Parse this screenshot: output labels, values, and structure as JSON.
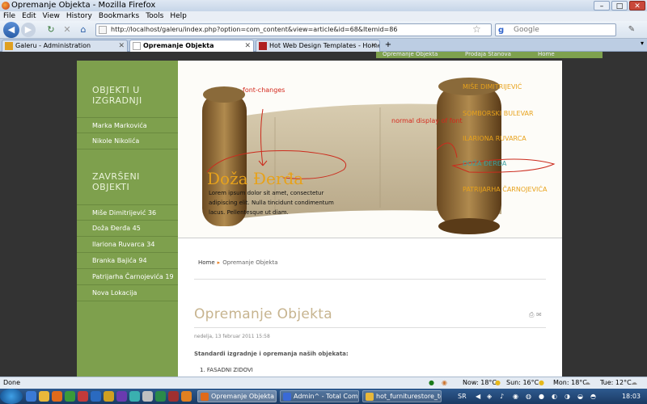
{
  "window": {
    "title": "Opremanje Objekta - Mozilla Firefox",
    "min": "–",
    "max": "□",
    "close": "✕"
  },
  "menu": [
    "File",
    "Edit",
    "View",
    "History",
    "Bookmarks",
    "Tools",
    "Help"
  ],
  "nav": {
    "url": "http://localhost/galeru/index.php?option=com_content&view=article&id=68&Itemid=86",
    "search_placeholder": "Google"
  },
  "tabs": [
    {
      "label": "Galeru - Administration",
      "active": false
    },
    {
      "label": "Opremanje Objekta",
      "active": true
    },
    {
      "label": "Hot Web Design Templates - Home",
      "active": false
    }
  ],
  "site": {
    "top_menu": [
      "Opremanje Objekta",
      "Prodaja Stanova",
      "Home"
    ],
    "sidebar": {
      "section1_title": "OBJEKTI U IZGRADNJI",
      "section1_items": [
        "Marka Markovića",
        "Nikole Nikolića"
      ],
      "section2_title": "ZAVRŠENI OBJEKTI",
      "section2_items": [
        "Miše Dimitrijević 36",
        "Doža Đerđa 45",
        "Ilariona Ruvarca 34",
        "Branka Bajića 94",
        "Patrijarha Čarnojevića 19",
        "Nova Lokacija"
      ]
    },
    "banner": {
      "annotation_font": "font-changes",
      "annotation_normal": "normal display of font",
      "scroll_title": "Doža Đerđa",
      "scroll_text": "Lorem ipsum dolor sit amet, consectetur adipiscing elit. Nulla tincidunt condimentum lacus. Pellentesque ut diam.",
      "right_links": [
        "MIŠE DIMITRIJEVIĆ",
        "SOMBORSKI BULEVAR",
        "ILARIONA RUVARCA",
        "DOŽA ĐERĐA",
        "PATRIJARHA ČARNOJEVIĆA"
      ]
    },
    "breadcrumb": {
      "home": "Home",
      "current": "Opremanje Objekta"
    },
    "page_title": "Opremanje Objekta",
    "date": "nedelja, 13 februar 2011 15:58",
    "body_intro": "Standardi izgradnje i opremanja naših objekata:",
    "list": [
      "1.   FASADNI ZIDOVI"
    ]
  },
  "status": {
    "text": "Done",
    "weather": [
      "Now: 18°C",
      "Sun: 16°C",
      "Mon: 18°C",
      "Tue: 12°C"
    ]
  },
  "taskbar": {
    "items": [
      "Opremanje Objekta -...",
      "Admin^ - Total Com...",
      "hot_furniturestore_te..."
    ],
    "lang": "SR",
    "clock": "18:03"
  },
  "colors": {
    "sidebar": "#7ea04d",
    "accent": "#e8a21b",
    "annotation": "#d4281c"
  }
}
